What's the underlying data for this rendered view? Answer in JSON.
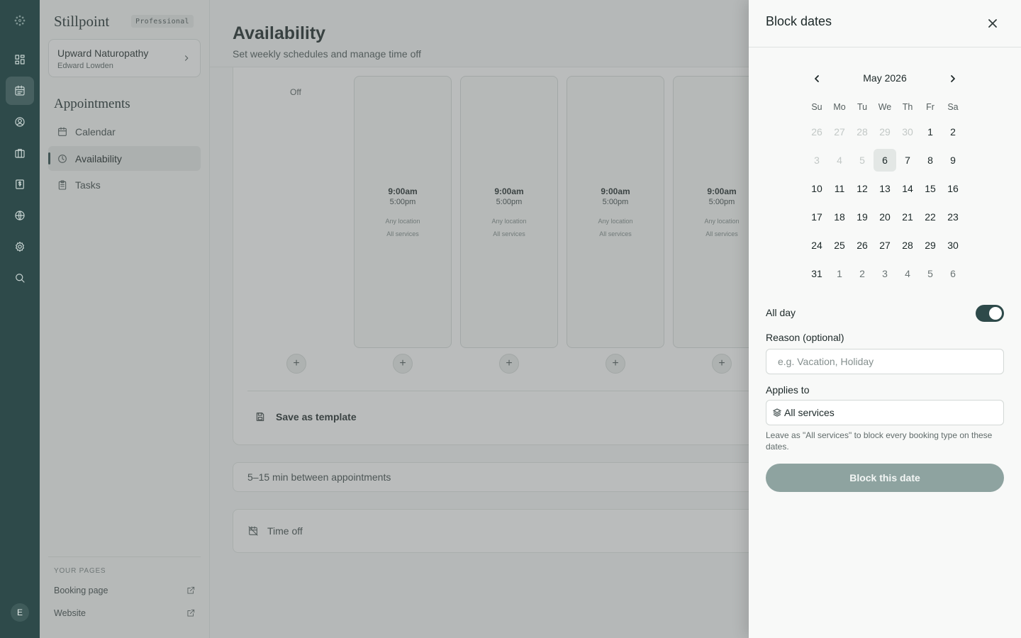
{
  "app": {
    "brand": "Stillpoint",
    "plan_badge": "Professional"
  },
  "rail": {
    "icons": [
      "logo-icon",
      "dashboard-icon",
      "calendar-icon",
      "clients-icon",
      "briefcase-icon",
      "billing-icon",
      "globe-icon",
      "settings-icon",
      "search-icon"
    ],
    "active": "calendar-icon",
    "avatar_initial": "E"
  },
  "sidebar": {
    "practice_name": "Upward Naturopathy",
    "practice_user": "Edward Lowden",
    "section_title": "Appointments",
    "items": [
      {
        "label": "Calendar",
        "icon": "calendar-icon"
      },
      {
        "label": "Availability",
        "icon": "clock-icon",
        "active": true
      },
      {
        "label": "Tasks",
        "icon": "clipboard-icon"
      }
    ],
    "pages_heading": "YOUR PAGES",
    "pages": [
      {
        "label": "Booking page",
        "icon": "external-link-icon"
      },
      {
        "label": "Website",
        "icon": "external-link-icon"
      }
    ]
  },
  "main": {
    "title": "Availability",
    "subtitle": "Set weekly schedules and manage time off",
    "off_label": "Off",
    "days": [
      {
        "start": "9:00am",
        "end": "5:00pm",
        "location": "Any location",
        "services": "All services"
      },
      {
        "start": "9:00am",
        "end": "5:00pm",
        "location": "Any location",
        "services": "All services"
      },
      {
        "start": "9:00am",
        "end": "5:00pm",
        "location": "Any location",
        "services": "All services"
      },
      {
        "start": "9:00am",
        "end": "5:00pm",
        "location": "Any location",
        "services": "All services"
      }
    ],
    "add_symbol": "+",
    "save_template_label": "Save as template",
    "buffer_label": "5–15 min between appointments",
    "time_off_label": "Time off"
  },
  "drawer": {
    "title": "Block dates",
    "calendar": {
      "month_label": "May 2026",
      "weekdays": [
        "Su",
        "Mo",
        "Tu",
        "We",
        "Th",
        "Fr",
        "Sa"
      ],
      "weeks": [
        [
          "26",
          "27",
          "28",
          "29",
          "30",
          "1",
          "2"
        ],
        [
          "3",
          "4",
          "5",
          "6",
          "7",
          "8",
          "9"
        ],
        [
          "10",
          "11",
          "12",
          "13",
          "14",
          "15",
          "16"
        ],
        [
          "17",
          "18",
          "19",
          "20",
          "21",
          "22",
          "23"
        ],
        [
          "24",
          "25",
          "26",
          "27",
          "28",
          "29",
          "30"
        ],
        [
          "31",
          "1",
          "2",
          "3",
          "4",
          "5",
          "6"
        ]
      ],
      "today": "6"
    },
    "all_day_label": "All day",
    "all_day_on": true,
    "reason_label": "Reason (optional)",
    "reason_placeholder": "e.g. Vacation, Holiday",
    "reason_value": "",
    "applies_label": "Applies to",
    "applies_value": "All services",
    "helper_text": "Leave as \"All services\" to block every booking type on these dates.",
    "submit_label": "Block this date"
  }
}
